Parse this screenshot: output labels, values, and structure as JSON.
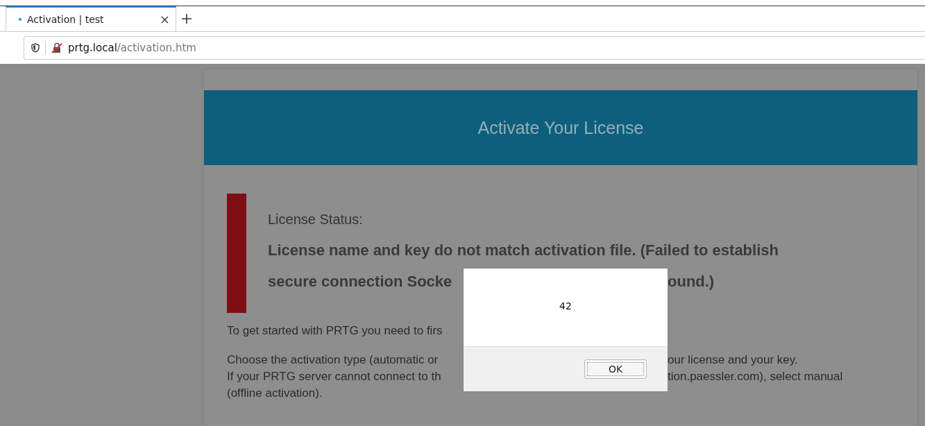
{
  "browser": {
    "tabs": [
      {
        "label": "Activation | test",
        "selected": true
      }
    ],
    "address": {
      "host": "prtg.local",
      "path": "/activation.htm"
    }
  },
  "page": {
    "header_title": "Activate Your License",
    "status_label": "License Status:",
    "status_lines": [
      {
        "left": "License name and key do not match activation file. (Failed to establish"
      },
      {
        "left": "secure connection Socke",
        "right": "ound.)"
      }
    ],
    "paragraphs": [
      [
        {
          "left": "To get started with PRTG you need to firs"
        }
      ],
      [
        {
          "left": "Choose the activation type (automatic or",
          "right": "our license and your key."
        },
        {
          "left": "If your PRTG server cannot connect to th",
          "right": "tion.paessler.com), select manual"
        },
        {
          "left": "(offline activation)."
        }
      ]
    ]
  },
  "dialog": {
    "message": "42",
    "buttons": [
      "OK"
    ]
  }
}
